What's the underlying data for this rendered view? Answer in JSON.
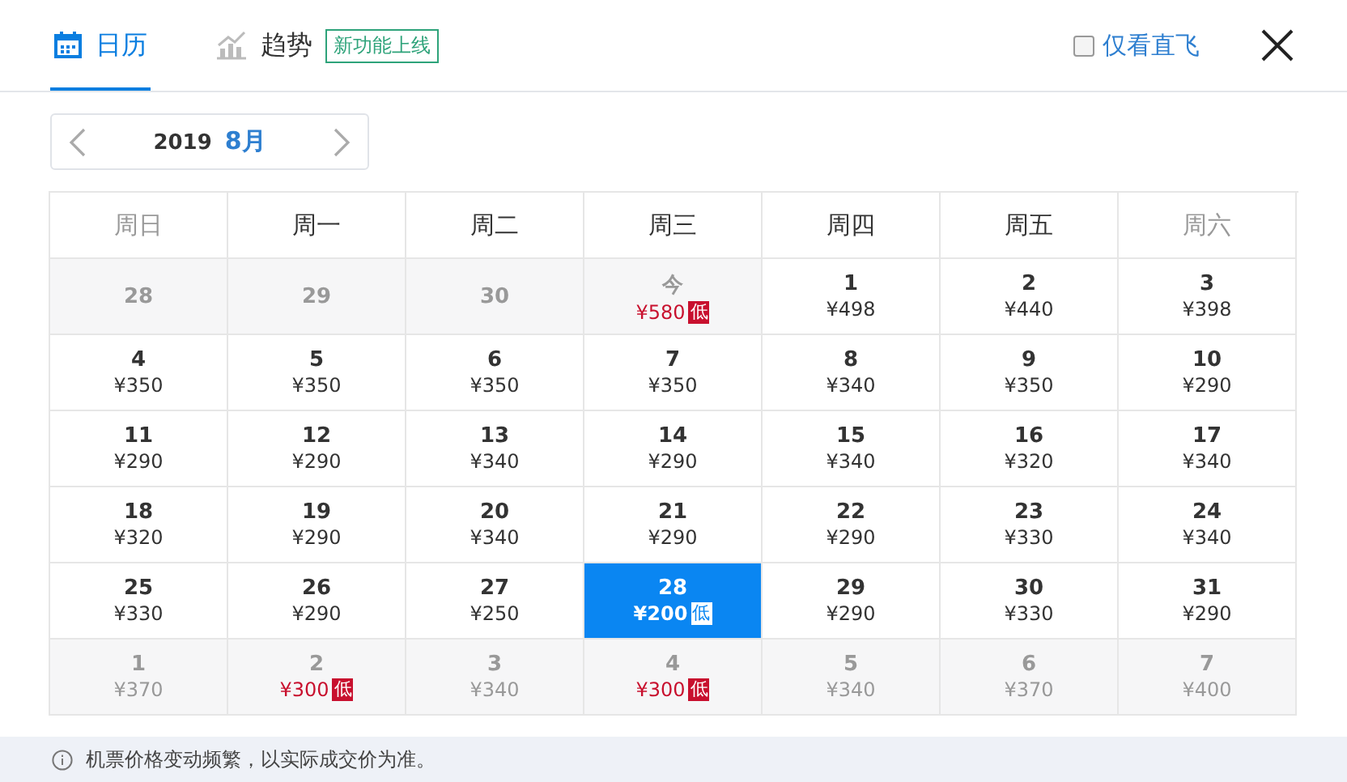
{
  "tabs": [
    {
      "label": "日历",
      "selected": true,
      "kind": "calendar"
    },
    {
      "label": "趋势",
      "selected": false,
      "kind": "trend",
      "badge": "新功能上线"
    }
  ],
  "direct_only": {
    "label": "仅看直飞",
    "checked": false
  },
  "month_nav": {
    "year": "2019",
    "month": "8月"
  },
  "weekdays": [
    {
      "label": "周日",
      "weekend": true
    },
    {
      "label": "周一",
      "weekend": false
    },
    {
      "label": "周二",
      "weekend": false
    },
    {
      "label": "周三",
      "weekend": false
    },
    {
      "label": "周四",
      "weekend": false
    },
    {
      "label": "周五",
      "weekend": false
    },
    {
      "label": "周六",
      "weekend": true
    }
  ],
  "days": [
    {
      "day": "28",
      "muted": true,
      "selected": false
    },
    {
      "day": "29",
      "muted": true,
      "selected": false
    },
    {
      "day": "30",
      "muted": true,
      "selected": false
    },
    {
      "day": "今",
      "price": "¥580",
      "low": "低",
      "muted": true,
      "selected": false
    },
    {
      "day": "1",
      "price": "¥498",
      "muted": false,
      "selected": false
    },
    {
      "day": "2",
      "price": "¥440",
      "muted": false,
      "selected": false
    },
    {
      "day": "3",
      "price": "¥398",
      "muted": false,
      "selected": false
    },
    {
      "day": "4",
      "price": "¥350",
      "muted": false,
      "selected": false
    },
    {
      "day": "5",
      "price": "¥350",
      "muted": false,
      "selected": false
    },
    {
      "day": "6",
      "price": "¥350",
      "muted": false,
      "selected": false
    },
    {
      "day": "7",
      "price": "¥350",
      "muted": false,
      "selected": false
    },
    {
      "day": "8",
      "price": "¥340",
      "muted": false,
      "selected": false
    },
    {
      "day": "9",
      "price": "¥350",
      "muted": false,
      "selected": false
    },
    {
      "day": "10",
      "price": "¥290",
      "muted": false,
      "selected": false
    },
    {
      "day": "11",
      "price": "¥290",
      "muted": false,
      "selected": false
    },
    {
      "day": "12",
      "price": "¥290",
      "muted": false,
      "selected": false
    },
    {
      "day": "13",
      "price": "¥340",
      "muted": false,
      "selected": false
    },
    {
      "day": "14",
      "price": "¥290",
      "muted": false,
      "selected": false
    },
    {
      "day": "15",
      "price": "¥340",
      "muted": false,
      "selected": false
    },
    {
      "day": "16",
      "price": "¥320",
      "muted": false,
      "selected": false
    },
    {
      "day": "17",
      "price": "¥340",
      "muted": false,
      "selected": false
    },
    {
      "day": "18",
      "price": "¥320",
      "muted": false,
      "selected": false
    },
    {
      "day": "19",
      "price": "¥290",
      "muted": false,
      "selected": false
    },
    {
      "day": "20",
      "price": "¥340",
      "muted": false,
      "selected": false
    },
    {
      "day": "21",
      "price": "¥290",
      "muted": false,
      "selected": false
    },
    {
      "day": "22",
      "price": "¥290",
      "muted": false,
      "selected": false
    },
    {
      "day": "23",
      "price": "¥330",
      "muted": false,
      "selected": false
    },
    {
      "day": "24",
      "price": "¥340",
      "muted": false,
      "selected": false
    },
    {
      "day": "25",
      "price": "¥330",
      "muted": false,
      "selected": false
    },
    {
      "day": "26",
      "price": "¥290",
      "muted": false,
      "selected": false
    },
    {
      "day": "27",
      "price": "¥250",
      "muted": false,
      "selected": false
    },
    {
      "day": "28",
      "price": "¥200",
      "low": "低",
      "muted": false,
      "selected": true
    },
    {
      "day": "29",
      "price": "¥290",
      "muted": false,
      "selected": false
    },
    {
      "day": "30",
      "price": "¥330",
      "muted": false,
      "selected": false
    },
    {
      "day": "31",
      "price": "¥290",
      "muted": false,
      "selected": false
    },
    {
      "day": "1",
      "price": "¥370",
      "muted": true,
      "selected": false
    },
    {
      "day": "2",
      "price": "¥300",
      "low": "低",
      "muted": true,
      "selected": false
    },
    {
      "day": "3",
      "price": "¥340",
      "muted": true,
      "selected": false
    },
    {
      "day": "4",
      "price": "¥300",
      "low": "低",
      "muted": true,
      "selected": false
    },
    {
      "day": "5",
      "price": "¥340",
      "muted": true,
      "selected": false
    },
    {
      "day": "6",
      "price": "¥370",
      "muted": true,
      "selected": false
    },
    {
      "day": "7",
      "price": "¥400",
      "muted": true,
      "selected": false
    }
  ],
  "notice": "机票价格变动频繁，以实际成交价为准。"
}
